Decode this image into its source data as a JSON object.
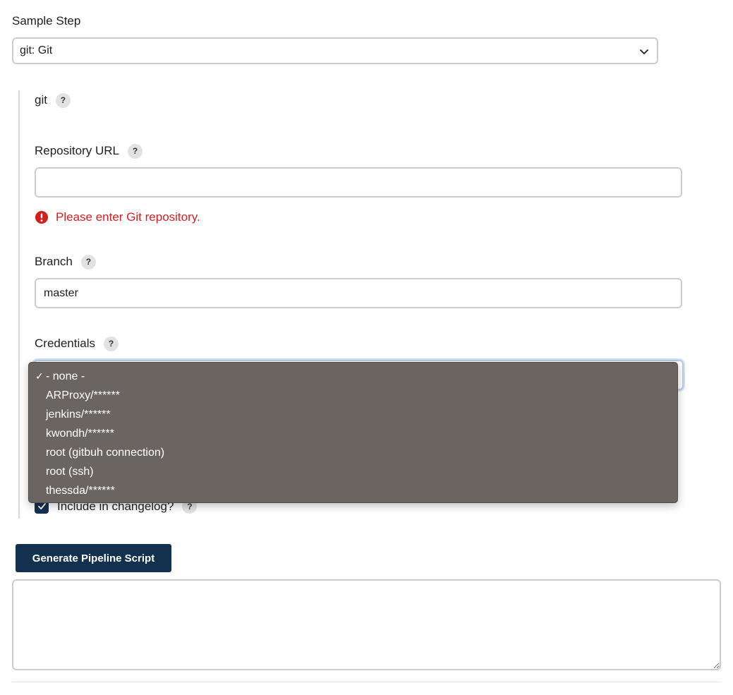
{
  "sample_step": {
    "label": "Sample Step",
    "selected": "git: Git"
  },
  "git_section": {
    "title": "git",
    "help_glyph": "?"
  },
  "repository_url": {
    "label": "Repository URL",
    "value": "",
    "error": "Please enter Git repository."
  },
  "branch": {
    "label": "Branch",
    "value": "master"
  },
  "credentials": {
    "label": "Credentials",
    "options": [
      {
        "label": "- none -",
        "selected": true
      },
      {
        "label": "ARProxy/******",
        "selected": false
      },
      {
        "label": "jenkins/******",
        "selected": false
      },
      {
        "label": "kwondh/******",
        "selected": false
      },
      {
        "label": "root (gitbuh connection)",
        "selected": false
      },
      {
        "label": "root (ssh)",
        "selected": false
      },
      {
        "label": "thessda/******",
        "selected": false
      }
    ],
    "check_glyph": "✓"
  },
  "changelog": {
    "label": "Include in changelog?",
    "checked": true
  },
  "generate_button": {
    "label": "Generate Pipeline Script"
  },
  "script_output": {
    "value": ""
  },
  "colors": {
    "primary": "#14304f",
    "error": "#d41f1f",
    "dropdown_bg": "#6b6562"
  }
}
